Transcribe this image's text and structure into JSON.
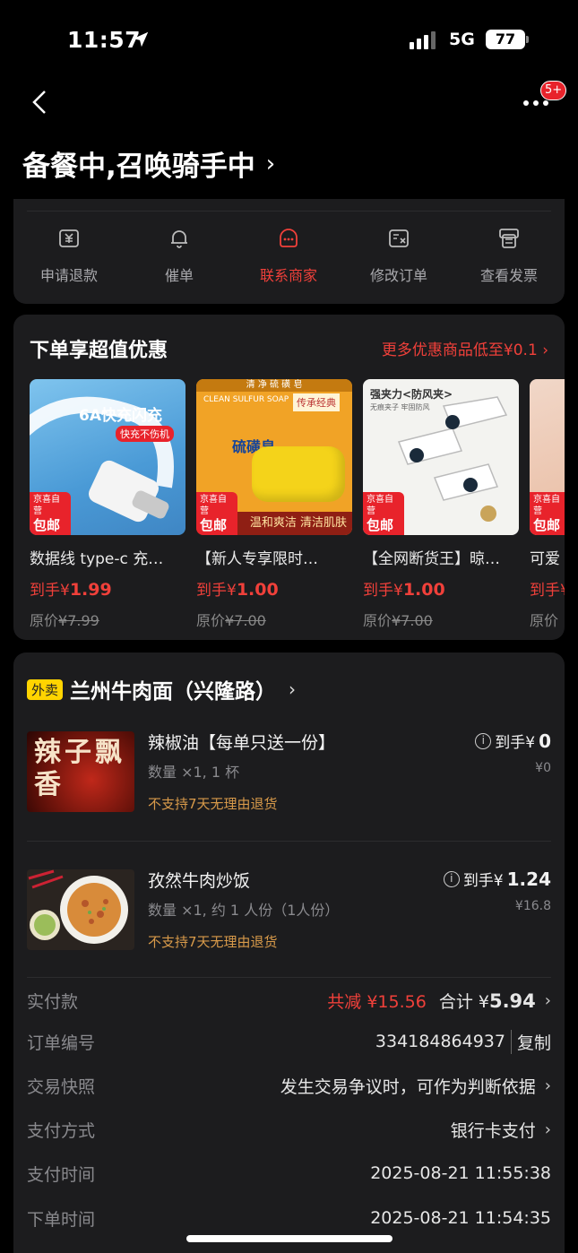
{
  "status_bar": {
    "time": "11:57",
    "network": "5G",
    "battery": "77"
  },
  "nav": {
    "badge": "5+",
    "title": "备餐中,召唤骑手中"
  },
  "actions": [
    {
      "label": "申请退款",
      "icon": "refund-icon"
    },
    {
      "label": "催单",
      "icon": "bell-icon"
    },
    {
      "label": "联系商家",
      "icon": "merchant-icon"
    },
    {
      "label": "修改订单",
      "icon": "edit-order-icon"
    },
    {
      "label": "查看发票",
      "icon": "invoice-icon"
    }
  ],
  "promo": {
    "title": "下单享超值优惠",
    "more": "更多优惠商品低至¥0.1",
    "products": [
      {
        "name": "数据线 type-c 充…",
        "price_prefix": "到手¥",
        "price": "1.99",
        "orig_prefix": "原价",
        "orig": "¥7.99",
        "tag_top": "京喜自营",
        "tag_bottom": "包邮",
        "img_text_1": "6A快充闪充",
        "img_text_2": "快充不伤机"
      },
      {
        "name": "【新人专享限时…",
        "price_prefix": "到手¥",
        "price": "1.00",
        "orig_prefix": "原价",
        "orig": "¥7.00",
        "tag_top": "京喜自营",
        "tag_bottom": "包邮",
        "img_text_1": "清 净 硫 磺 皂",
        "img_text_2": "CLEAN SULFUR SOAP",
        "img_text_3": "传承经典",
        "img_text_4": "温和爽洁 清洁肌肤",
        "img_text_5": "硫磺皂"
      },
      {
        "name": "【全网断货王】晾…",
        "price_prefix": "到手¥",
        "price": "1.00",
        "orig_prefix": "原价",
        "orig": "¥7.00",
        "tag_top": "京喜自营",
        "tag_bottom": "包邮",
        "img_text_1": "强夹力<防风夹>",
        "img_text_2": "无痕夹子 牢固防风"
      },
      {
        "name": "可爱",
        "price_prefix": "到手¥",
        "price": "",
        "orig_prefix": "原价",
        "orig": "",
        "tag_top": "京喜自营",
        "tag_bottom": "包邮"
      }
    ]
  },
  "store": {
    "tag": "外卖",
    "name": "兰州牛肉面（兴隆路）",
    "items": [
      {
        "name": "辣椒油【每单只送一份】",
        "qty": "数量 ×1, 1 杯",
        "note": "不支持7天无理由退货",
        "pay_prefix": "到手¥",
        "pay": "0",
        "orig": "¥0",
        "img_text": "辣子飘香"
      },
      {
        "name": "孜然牛肉炒饭",
        "qty": "数量 ×1, 约 1 人份（1人份）",
        "note": "不支持7天无理由退货",
        "pay_prefix": "到手¥",
        "pay": "1.24",
        "orig": "¥16.8"
      }
    ]
  },
  "summary": {
    "paid_label": "实付款",
    "discount": "共减 ¥15.56",
    "total_prefix": "合计 ¥",
    "total": "5.94",
    "order_no_label": "订单编号",
    "order_no": "334184864937",
    "copy": "复制",
    "snapshot_label": "交易快照",
    "snapshot": "发生交易争议时，可作为判断依据",
    "payment_label": "支付方式",
    "payment": "银行卡支付",
    "pay_time_label": "支付时间",
    "pay_time": "2025-08-21 11:55:38",
    "order_time_label": "下单时间",
    "order_time": "2025-08-21 11:54:35"
  },
  "colors": {
    "accent": "#f0403a",
    "card": "#1c1c1e",
    "tag_yellow": "#ffd400"
  }
}
